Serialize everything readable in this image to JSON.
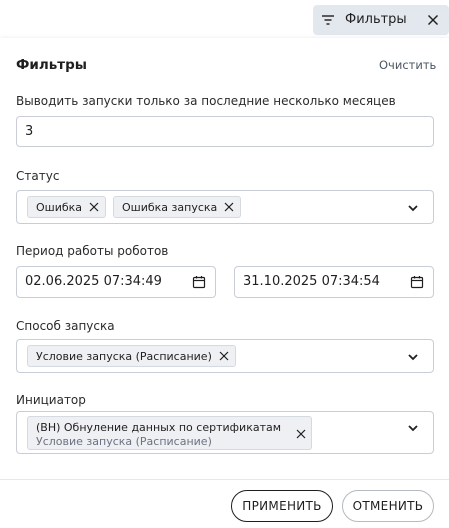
{
  "topbar": {
    "filters_label": "Фильтры"
  },
  "panel": {
    "title": "Фильтры",
    "clear_label": "Очистить",
    "months": {
      "label": "Выводить запуски только за последние несколько месяцев",
      "value": "3"
    },
    "status": {
      "label": "Статус",
      "chips": [
        "Ошибка",
        "Ошибка запуска"
      ]
    },
    "period": {
      "label": "Период работы роботов",
      "from": "02.06.2025 07:34:49",
      "to": "31.10.2025 07:34:54"
    },
    "launch_method": {
      "label": "Способ запуска",
      "chips": [
        "Условие запуска (Расписание)"
      ]
    },
    "initiator": {
      "label": "Инициатор",
      "chip_title": "(ВН) Обнуление данных по сертификатам",
      "chip_subtitle": "Условие запуска (Расписание)"
    }
  },
  "footer": {
    "apply_label": "ПРИМЕНИТЬ",
    "cancel_label": "ОТМЕНИТЬ"
  }
}
